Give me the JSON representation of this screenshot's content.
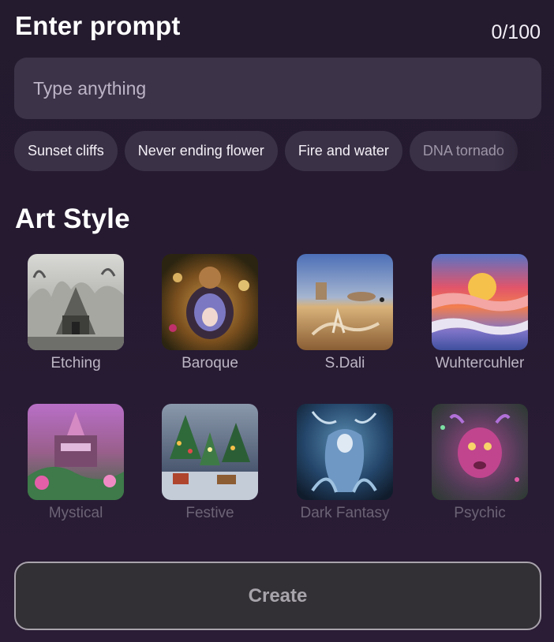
{
  "prompt": {
    "title": "Enter prompt",
    "counter": "0/100",
    "placeholder": "Type anything",
    "value": ""
  },
  "suggestions": [
    {
      "label": "Sunset cliffs"
    },
    {
      "label": "Never ending flower"
    },
    {
      "label": "Fire and water"
    },
    {
      "label": "DNA tornado"
    }
  ],
  "art_style": {
    "title": "Art Style",
    "styles": [
      {
        "label": "Etching",
        "icon": "etching-thumbnail"
      },
      {
        "label": "Baroque",
        "icon": "baroque-thumbnail"
      },
      {
        "label": "S.Dali",
        "icon": "sdali-thumbnail"
      },
      {
        "label": "Wuhtercuhler",
        "icon": "wuhtercuhler-thumbnail"
      },
      {
        "label": "Mystical",
        "icon": "mystical-thumbnail"
      },
      {
        "label": "Festive",
        "icon": "festive-thumbnail"
      },
      {
        "label": "Dark Fantasy",
        "icon": "dark-fantasy-thumbnail"
      },
      {
        "label": "Psychic",
        "icon": "psychic-thumbnail"
      }
    ]
  },
  "actions": {
    "create_label": "Create"
  },
  "colors": {
    "background": "#241b2e",
    "input_bg": "#3c3348",
    "chip_bg": "#3a3146",
    "button_bg": "#333035",
    "button_border": "#a9a3ad"
  }
}
